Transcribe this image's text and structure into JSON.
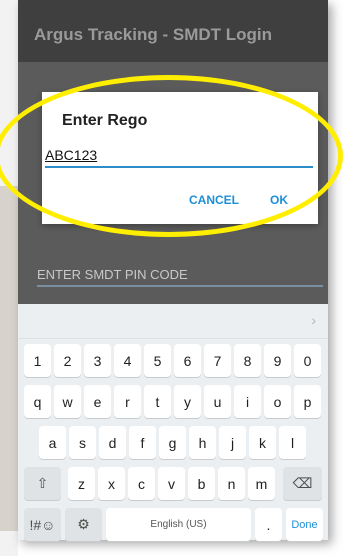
{
  "app": {
    "title": "Argus Tracking - SMDT Login"
  },
  "pin": {
    "placeholder": "ENTER SMDT PIN CODE"
  },
  "dialog": {
    "title": "Enter Rego",
    "input_value": "ABC123",
    "cancel_label": "CANCEL",
    "ok_label": "OK"
  },
  "keyboard": {
    "numbers": [
      "1",
      "2",
      "3",
      "4",
      "5",
      "6",
      "7",
      "8",
      "9",
      "0"
    ],
    "row1": [
      "q",
      "w",
      "e",
      "r",
      "t",
      "y",
      "u",
      "i",
      "o",
      "p"
    ],
    "row2": [
      "a",
      "s",
      "d",
      "f",
      "g",
      "h",
      "j",
      "k",
      "l"
    ],
    "row3": [
      "z",
      "x",
      "c",
      "v",
      "b",
      "n",
      "m"
    ],
    "shift": "⇧",
    "backspace": "⌫",
    "symbols": "!#☺",
    "settings": "⚙",
    "space_label": "English (US)",
    "period": ".",
    "done": "Done",
    "collapse": "›"
  },
  "colors": {
    "accent": "#1e8fd6",
    "highlight": "#ffee00",
    "appbar": "#3f3f3f",
    "screen": "#5b5b5b"
  }
}
